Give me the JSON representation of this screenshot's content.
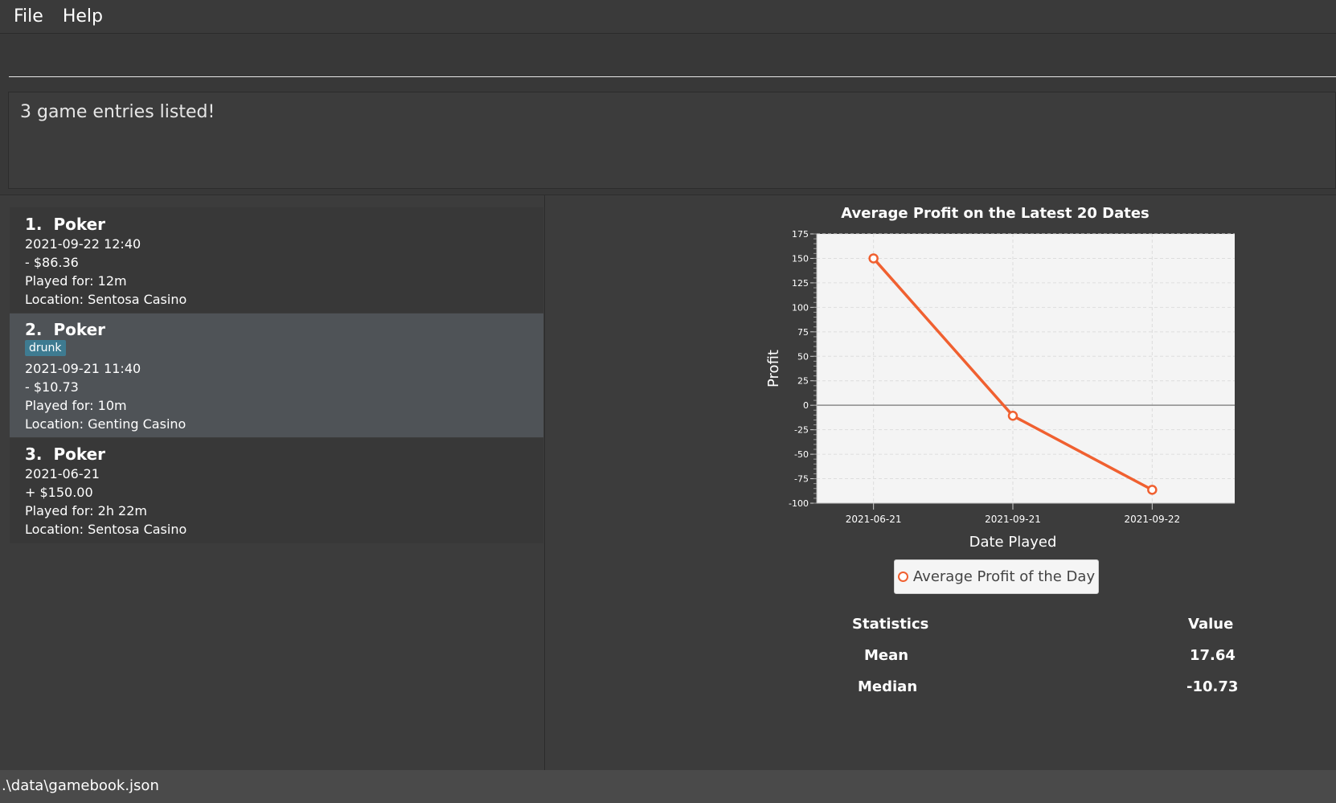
{
  "menu": {
    "file": "File",
    "help": "Help"
  },
  "command": {
    "value": "",
    "placeholder": ""
  },
  "result": {
    "message": "3 game entries listed!"
  },
  "entries": [
    {
      "index": "1.",
      "game": "Poker",
      "tags": [],
      "datetime": "2021-09-22 12:40",
      "profit": "- $86.36",
      "duration": "Played for: 12m",
      "location": "Location: Sentosa Casino"
    },
    {
      "index": "2.",
      "game": "Poker",
      "tags": [
        "drunk"
      ],
      "datetime": "2021-09-21 11:40",
      "profit": "- $10.73",
      "duration": "Played for: 10m",
      "location": "Location: Genting Casino"
    },
    {
      "index": "3.",
      "game": "Poker",
      "tags": [],
      "datetime": "2021-06-21",
      "profit": "+ $150.00",
      "duration": "Played for: 2h 22m",
      "location": "Location: Sentosa Casino"
    }
  ],
  "chart_data": {
    "type": "line",
    "title": "Average Profit on the Latest 20 Dates",
    "xlabel": "Date Played",
    "ylabel": "Profit",
    "categories": [
      "2021-06-21",
      "2021-09-21",
      "2021-09-22"
    ],
    "series": [
      {
        "name": "Average Profit of the Day",
        "values": [
          150.0,
          -10.73,
          -86.36
        ]
      }
    ],
    "ylim": [
      -100,
      175
    ],
    "yticks": [
      175,
      150,
      125,
      100,
      75,
      50,
      25,
      0,
      -25,
      -50,
      -75,
      -100
    ],
    "grid": true,
    "legend": "bottom-center",
    "line_color": "#f06030"
  },
  "statistics": {
    "header_label": "Statistics",
    "header_value": "Value",
    "rows": [
      {
        "label": "Mean",
        "value": "17.64"
      },
      {
        "label": "Median",
        "value": "-10.73"
      }
    ]
  },
  "status": {
    "path": ".\\data\\gamebook.json"
  }
}
